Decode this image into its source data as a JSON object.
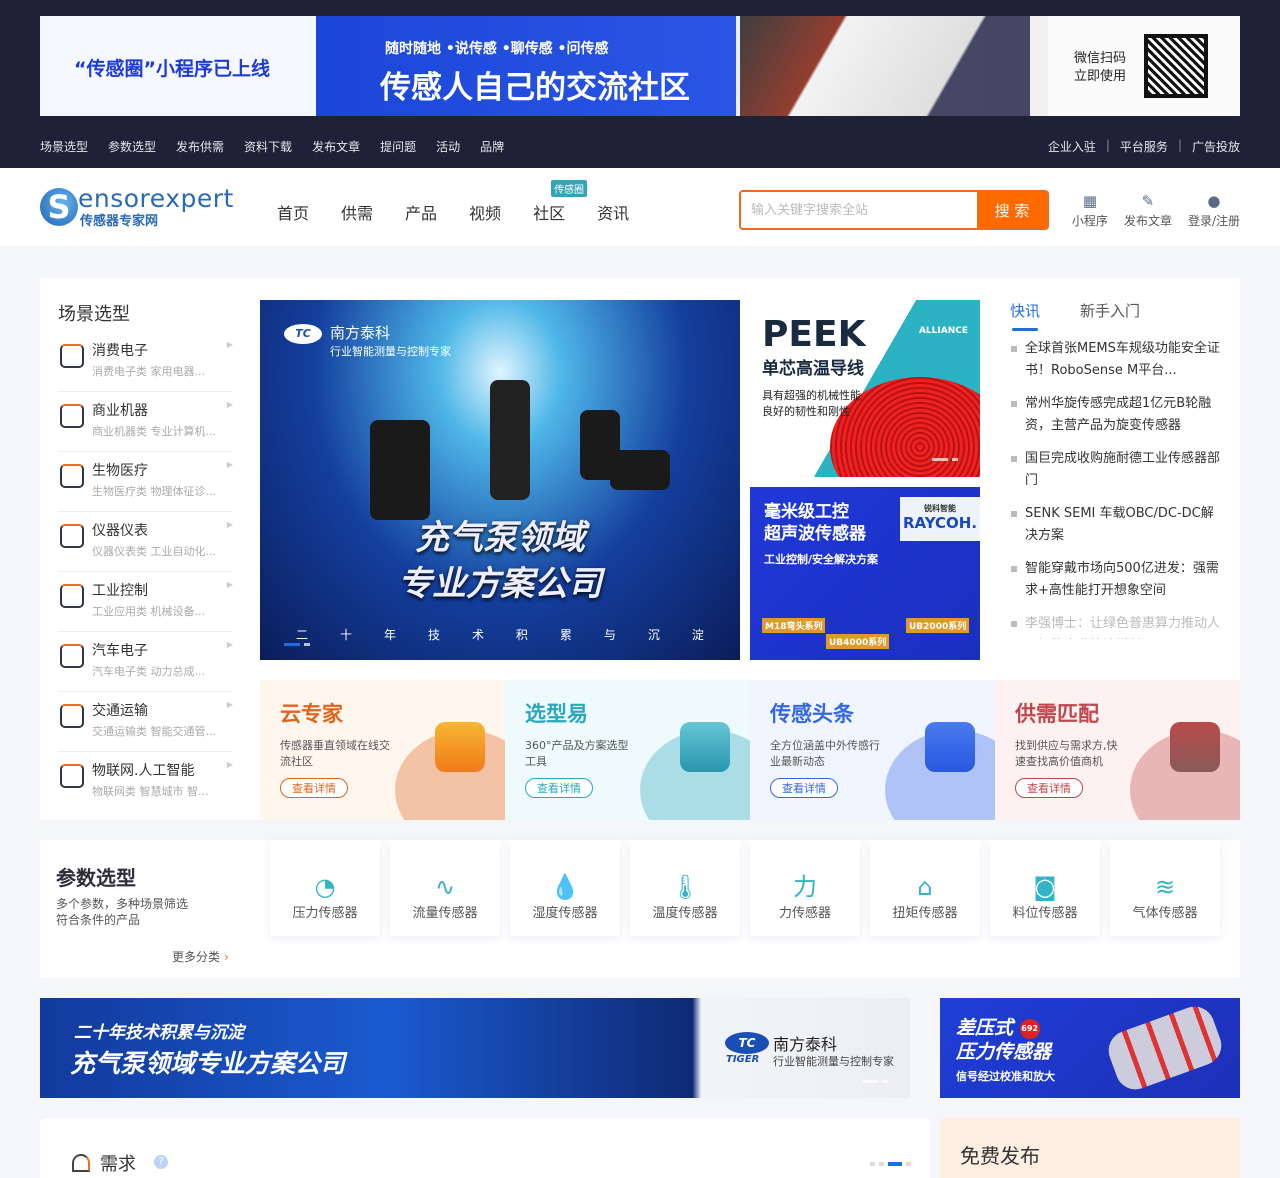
{
  "promo": {
    "left": "“传感圈”小程序已上线",
    "slogan_small": "随时随地 •说传感 •聊传感 •问传感",
    "slogan_big": "传感人自己的交流社区",
    "qr_text_1": "微信扫码",
    "qr_text_2": "立即使用"
  },
  "top_nav": {
    "left": [
      "场景选型",
      "参数选型",
      "发布供需",
      "资料下载",
      "发布文章",
      "提问题",
      "活动",
      "品牌"
    ],
    "right": [
      "企业入驻",
      "平台服务",
      "广告投放"
    ],
    "separator": "|"
  },
  "logo": {
    "en": "ensorexpert",
    "letter": "S",
    "cn": "传感器专家网"
  },
  "main_nav": {
    "items": [
      "首页",
      "供需",
      "产品",
      "视频",
      "社区",
      "资讯"
    ],
    "community_tag": "传感圈"
  },
  "search": {
    "placeholder": "输入关键字搜索全站",
    "value": "",
    "button": "搜 索"
  },
  "header_actions": [
    {
      "label": "小程序",
      "icon": "qr-icon"
    },
    {
      "label": "发布文章",
      "icon": "pen-icon"
    },
    {
      "label": "登录/注册",
      "icon": "user-icon"
    }
  ],
  "scenario": {
    "title": "场景选型",
    "items": [
      {
        "title": "消费电子",
        "sub": "消费电子类   家用电器..."
      },
      {
        "title": "商业机器",
        "sub": "商业机器类   专业计算机..."
      },
      {
        "title": "生物医疗",
        "sub": "生物医疗类   物理体征诊..."
      },
      {
        "title": "仪器仪表",
        "sub": "仪器仪表类   工业自动化..."
      },
      {
        "title": "工业控制",
        "sub": "工业应用类   机械设备..."
      },
      {
        "title": "汽车电子",
        "sub": "汽车电子类   动力总成..."
      },
      {
        "title": "交通运输",
        "sub": "交通运输类   智能交通管..."
      },
      {
        "title": "物联网.人工智能",
        "sub": "物联网类   智慧城市   智..."
      }
    ]
  },
  "carousel": {
    "brand_logo": "TC",
    "brand": "南方泰科",
    "brand_sub": "行业智能测量与控制专家",
    "headline_1": "充气泵领域",
    "headline_2": "专业方案公司",
    "tagline": [
      "二",
      "十",
      "年",
      "技",
      "术",
      "积",
      "累",
      "与",
      "沉",
      "淀"
    ]
  },
  "ad_peek": {
    "title": "PEEK",
    "subtitle": "单芯高温导线",
    "desc_1": "具有超强的机械性能",
    "desc_2": "良好的韧性和刚性",
    "brand": "ALLIANCE"
  },
  "ad_raycoh": {
    "title_1": "毫米级工控",
    "title_2": "超声波传感器",
    "sub": "工业控制/安全解决方案",
    "brand": "RAYCOH.",
    "brand_cn": "锐科智能",
    "tags": [
      "M18弯头系列",
      "UB4000系列",
      "UB2000系列"
    ]
  },
  "news": {
    "tabs": [
      "快讯",
      "新手入门"
    ],
    "items": [
      "全球首张MEMS车规级功能安全证书！RoboSense M平台...",
      "常州华旋传感完成超1亿元B轮融资，主营产品为旋变传感器",
      "国巨完成收购施耐德工业传感器部门",
      "SENK  SEMI 车载OBC/DC-DC解决方案",
      "智能穿戴市场向500亿进发：强需求+高性能打开想象空间",
      "李强博士：让绿色普惠算力推动人工智能产业快速增长"
    ]
  },
  "features": [
    {
      "title": "云专家",
      "desc": "传感器垂直领域在线交流社区",
      "button": "查看详情",
      "color": "#e0641c"
    },
    {
      "title": "选型易",
      "desc": "360°产品及方案选型工具",
      "button": "查看详情",
      "color": "#2aa7bd"
    },
    {
      "title": "传感头条",
      "desc": "全方位涵盖中外传感行业最新动态",
      "button": "查看详情",
      "color": "#3466e8"
    },
    {
      "title": "供需匹配",
      "desc": "找到供应与需求方,快速查找高价值商机",
      "button": "查看详情",
      "color": "#c0474b"
    }
  ],
  "param": {
    "title": "参数选型",
    "desc_1": "多个参数，多种场景筛选",
    "desc_2": "符合条件的产品",
    "more": "更多分类",
    "sensors": [
      "压力传感器",
      "流量传感器",
      "湿度传感器",
      "温度传感器",
      "力传感器",
      "扭矩传感器",
      "料位传感器",
      "气体传感器"
    ]
  },
  "banner_left": {
    "line1": "二十年技术积累与沉淀",
    "line2": "充气泵领域专业方案公司",
    "logo": "TC",
    "logo_sub": "TIGER",
    "brand": "南方泰科",
    "brand_sub": "行业智能测量与控制专家"
  },
  "banner_right": {
    "line1": "差压式",
    "badge": "692",
    "line2": "压力传感器",
    "sub": "信号经过校准和放大"
  },
  "demand": {
    "title": "需求",
    "help": "?"
  },
  "free": {
    "title": "免费发布"
  }
}
